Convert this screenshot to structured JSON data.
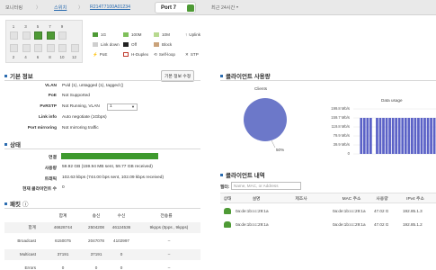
{
  "breadcrumb": {
    "root": "모니터링",
    "switch": "스위치",
    "device": "R214T7100A01234",
    "port": "Port 7",
    "range": "최근 24시간"
  },
  "ports": {
    "top": [
      "1",
      "3",
      "5",
      "7",
      "9"
    ],
    "bottom": [
      "2",
      "4",
      "6",
      "8",
      "10",
      "12"
    ],
    "up_ports": [
      "5",
      "7"
    ]
  },
  "legend": {
    "row1": [
      "1G",
      "100M",
      "10M",
      "Uplink"
    ],
    "row2": [
      "Link down",
      "Off",
      "Block"
    ],
    "row3": [
      "PoE",
      "H-Duplex",
      "Self-loop",
      "STP"
    ],
    "colors": {
      "1G": "#4e9a35",
      "100M": "#7fbf5a",
      "10M": "#b7d98f",
      "linkdown": "#cfcfcf",
      "off": "#222222",
      "block": "#c9a27a"
    }
  },
  "info": {
    "title": "기본 정보",
    "edit_button": "기본 정보 수정",
    "rows": [
      {
        "label": "VLAN",
        "value": "Pvid (1), untagged (1), tagged ()"
      },
      {
        "label": "PoE",
        "value": "Not Supported"
      },
      {
        "label": "PvRSTP",
        "value": "Not Running, VLAN"
      },
      {
        "label": "Link info",
        "value": "Auto negotiate (1Gbps)"
      },
      {
        "label": "Port mirroring",
        "value": "Not mirroring traffic"
      }
    ],
    "vlan_select": "1"
  },
  "status": {
    "title": "상태",
    "rows": [
      {
        "label": "연결",
        "value": ""
      },
      {
        "label": "사용량",
        "value": "59.92 GB (159.94 MB sent, 59.77 GB received)"
      },
      {
        "label": "트래픽",
        "value": "102.63 kbps (744.00 bps sent, 102.09 kbps received)"
      },
      {
        "label": "현재 클라이언트 수",
        "value": "0"
      }
    ]
  },
  "packets": {
    "title": "패킷",
    "headers": [
      "합계",
      "송신",
      "수신",
      "전송률"
    ],
    "rows": [
      {
        "name": "합계",
        "total": "46628744",
        "sent": "2504208",
        "recv": "46124536",
        "rate": "9kpps (0pps , 9kpps)"
      },
      {
        "name": "Broadcast",
        "total": "6150075",
        "sent": "2047078",
        "recv": "4102997",
        "rate": "–"
      },
      {
        "name": "Multicast",
        "total": "37191",
        "sent": "37191",
        "recv": "0",
        "rate": "–"
      },
      {
        "name": "Errors",
        "total": "0",
        "sent": "0",
        "recv": "0",
        "rate": "–"
      }
    ]
  },
  "usage": {
    "title": "클라이언트 사용량",
    "clients_label": "Clients",
    "pie_label": "50%",
    "data_title": "Data usage",
    "ticks": [
      "199.8 Mb/s",
      "159.7 Mb/s",
      "119.8 Mb/s",
      "79.9 Mb/s",
      "39.9 Mb/s",
      "0"
    ]
  },
  "clients": {
    "title": "클라이언트 내역",
    "filter_label": "필터:",
    "search_placeholder": "Name, MAC, or Address",
    "headers": [
      "상태",
      "설명",
      "제조사",
      "MAC 주소",
      "사용량",
      "IPv4 주소"
    ],
    "rows": [
      {
        "desc": "0a:de:1b:cc:29:1a",
        "mac": "0a:de:1b:cc:29:1a",
        "usage": "47.02 G",
        "ip": "192.85.1.3"
      },
      {
        "desc": "0a:de:1b:cc:29:1a",
        "mac": "0a:de:1b:cc:29:1a",
        "usage": "47.02 G",
        "ip": "192.85.1.2"
      }
    ]
  },
  "chart_data": [
    {
      "type": "pie",
      "title": "Clients",
      "categories": [
        ""
      ],
      "values": [
        100
      ],
      "labels": [
        "50%"
      ],
      "colors": [
        "#6c78c9"
      ]
    },
    {
      "type": "bar",
      "title": "Data usage",
      "ylim": [
        0,
        199.8
      ],
      "yticks": [
        "199.8 Mb/s",
        "159.7 Mb/s",
        "119.8 Mb/s",
        "79.9 Mb/s",
        "39.9 Mb/s",
        "0"
      ],
      "values": [
        0,
        0,
        160,
        160,
        160,
        160,
        0,
        160,
        160,
        160,
        160,
        160,
        160,
        160,
        160,
        160,
        160,
        160,
        160,
        160,
        160,
        160,
        160,
        160,
        160,
        160
      ],
      "color": "#5b62c7"
    }
  ]
}
